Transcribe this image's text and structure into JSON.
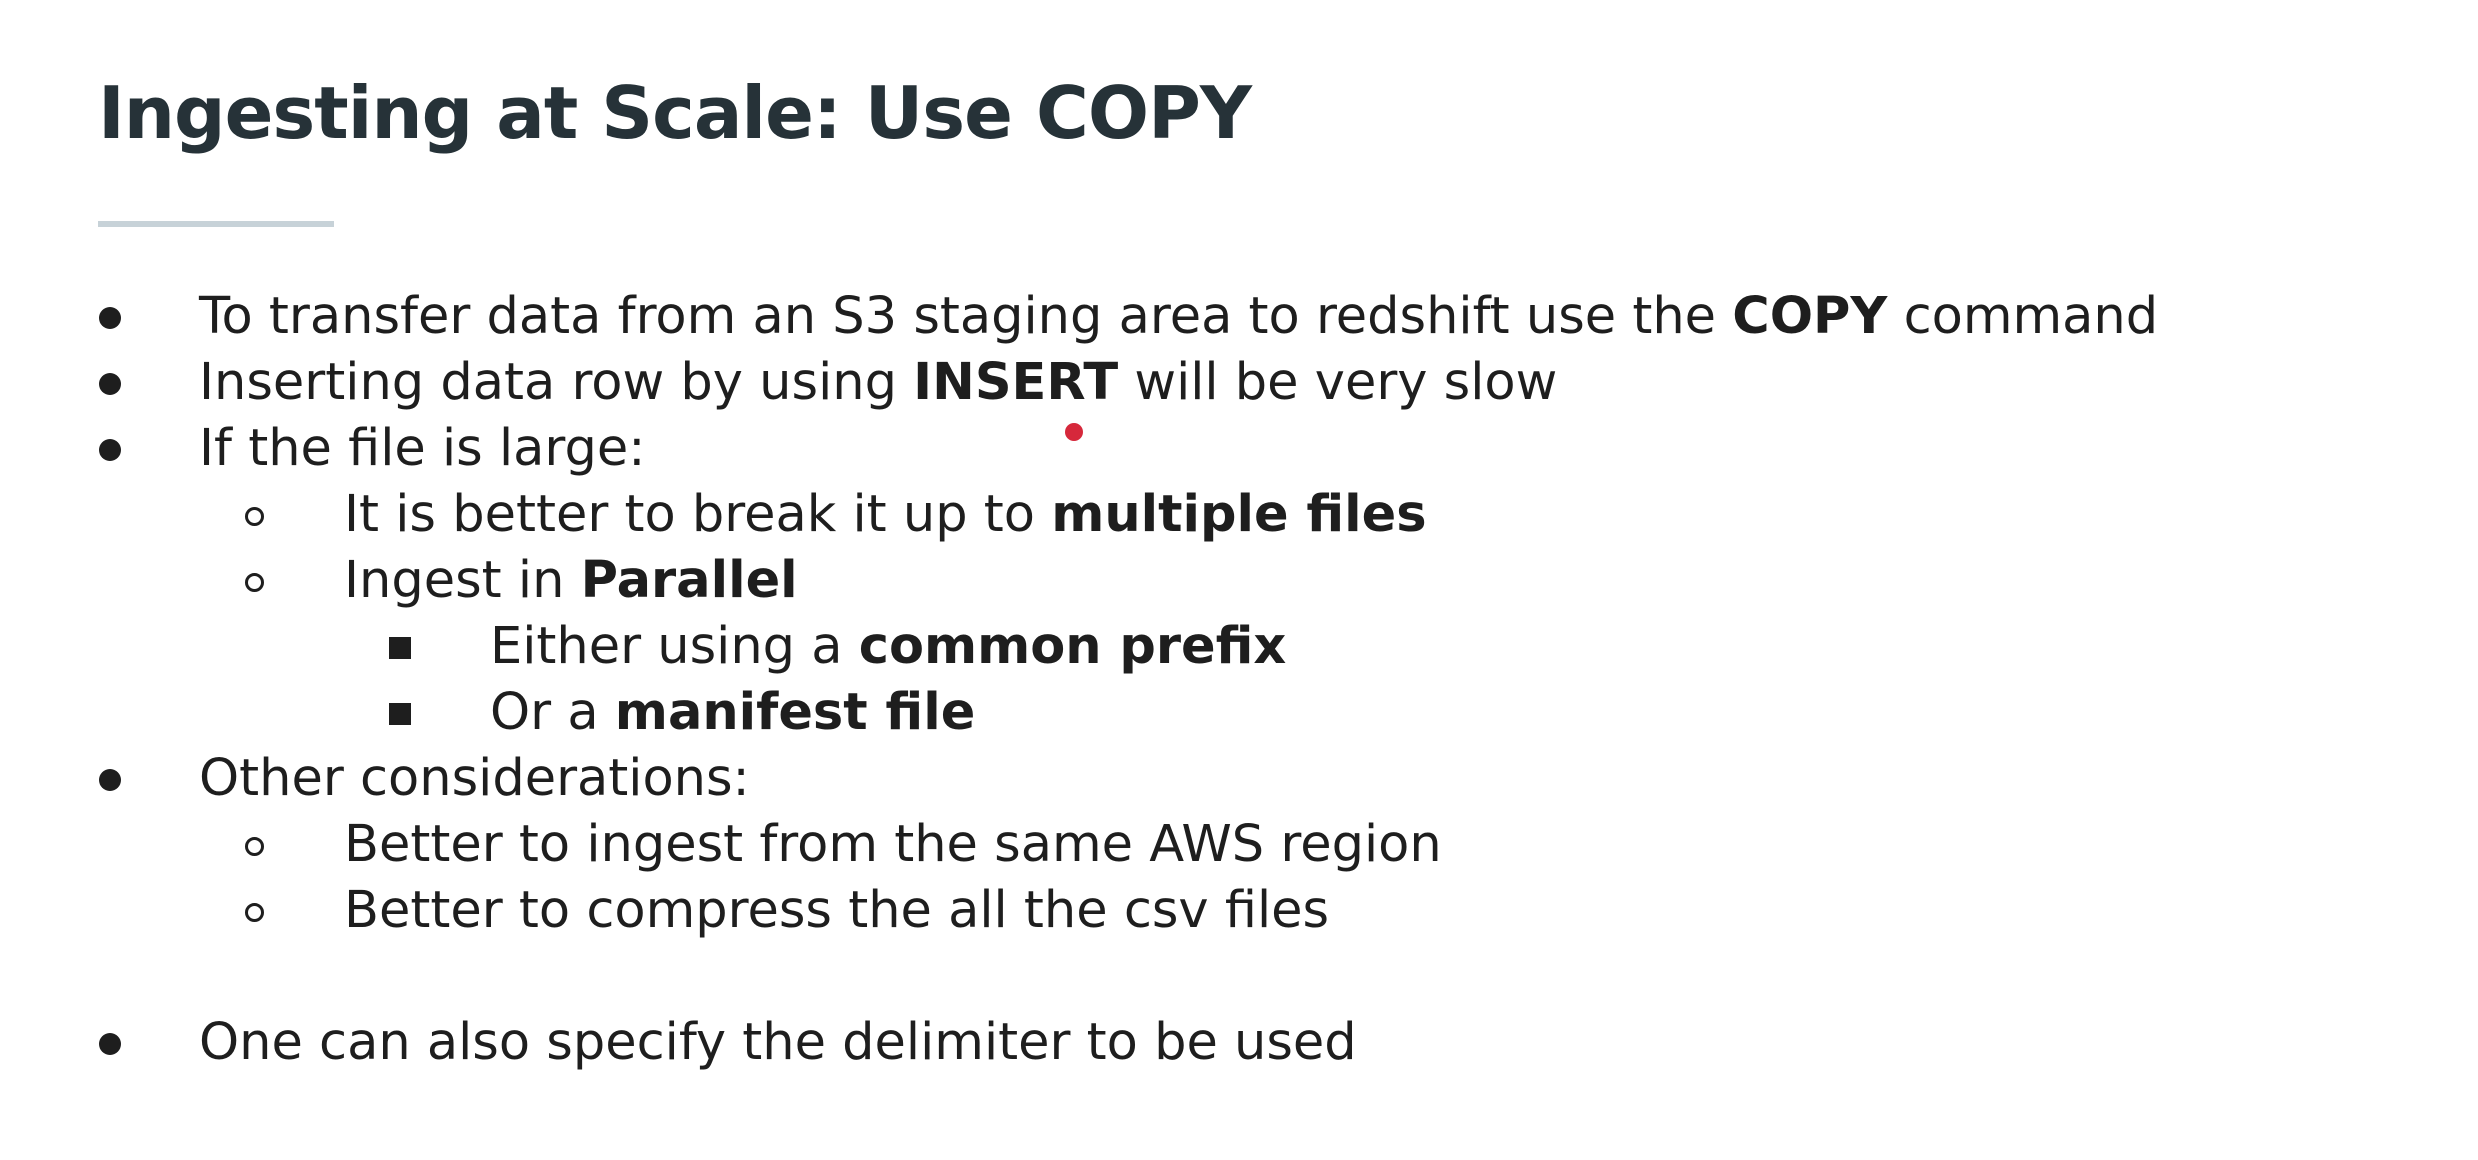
{
  "slide": {
    "title": "Ingesting at Scale: Use COPY",
    "bullets": [
      {
        "level": 1,
        "parts": [
          {
            "text": "To transfer data from an S3 staging area to redshift use the ",
            "bold": false
          },
          {
            "text": "COPY",
            "bold": true
          },
          {
            "text": " command",
            "bold": false
          }
        ]
      },
      {
        "level": 1,
        "parts": [
          {
            "text": "Inserting data row by using ",
            "bold": false
          },
          {
            "text": "INSERT",
            "bold": true
          },
          {
            "text": " will be very slow",
            "bold": false
          }
        ]
      },
      {
        "level": 1,
        "parts": [
          {
            "text": "If the file is large:",
            "bold": false
          }
        ]
      },
      {
        "level": 2,
        "parts": [
          {
            "text": "It is better to break it up to ",
            "bold": false
          },
          {
            "text": "multiple files",
            "bold": true
          }
        ]
      },
      {
        "level": 2,
        "parts": [
          {
            "text": "Ingest in ",
            "bold": false
          },
          {
            "text": "Parallel",
            "bold": true
          }
        ]
      },
      {
        "level": 3,
        "parts": [
          {
            "text": "Either using a ",
            "bold": false
          },
          {
            "text": "common prefix",
            "bold": true
          }
        ]
      },
      {
        "level": 3,
        "parts": [
          {
            "text": "Or a ",
            "bold": false
          },
          {
            "text": "manifest file",
            "bold": true
          }
        ]
      },
      {
        "level": 1,
        "parts": [
          {
            "text": "Other considerations:",
            "bold": false
          }
        ]
      },
      {
        "level": 2,
        "parts": [
          {
            "text": "Better to ingest from the same AWS region",
            "bold": false
          }
        ]
      },
      {
        "level": 2,
        "parts": [
          {
            "text": "Better to compress the all the csv files",
            "bold": false
          }
        ]
      },
      {
        "level": 1,
        "parts": [
          {
            "text": "One can also specify the delimiter to be used",
            "bold": false
          }
        ]
      }
    ]
  },
  "colors": {
    "title": "#263238",
    "text": "#1e1e1e",
    "rule": "#c7d2d8",
    "pointer": "#d6283b"
  }
}
